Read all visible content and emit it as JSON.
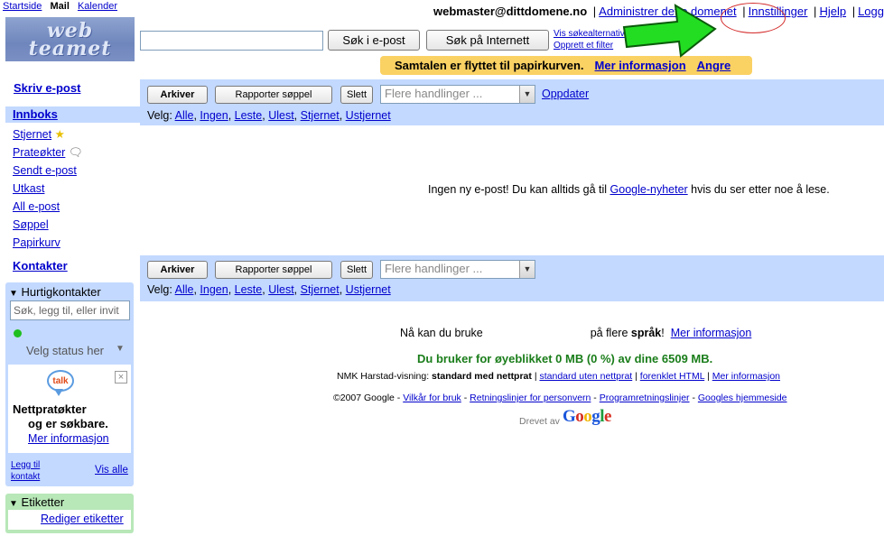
{
  "topnav": {
    "items": [
      "Startside",
      "Mail",
      "Kalender"
    ]
  },
  "logo": {
    "line1": "web",
    "line2": "teamet"
  },
  "user": {
    "email": "webmaster@dittdomene.no",
    "links": [
      "Administrer dette domenet",
      "Innstillinger",
      "Hjelp",
      "Logg av"
    ]
  },
  "search": {
    "value": "",
    "mail_button": "Søk i e-post",
    "web_button": "Søk på Internett",
    "options": "Vis søkealternativ",
    "filter": "Opprett et filter"
  },
  "notice": {
    "text": "Samtalen er flyttet til papirkurven.",
    "more": "Mer informasjon",
    "undo": "Angre"
  },
  "sidebar": {
    "compose": "Skriv e-post",
    "inbox": "Innboks",
    "items": [
      "Stjernet",
      "Prateøkter",
      "Sendt e-post",
      "Utkast",
      "All e-post",
      "Søppel",
      "Papirkurv"
    ],
    "contacts": "Kontakter"
  },
  "quickcontacts": {
    "title": "Hurtigkontakter",
    "search_placeholder": "Søk, legg til, eller invit",
    "status": "Velg status her",
    "talk_icon": "talk",
    "talk_line1": "Nettpratøkter",
    "talk_line2": "og er søkbare.",
    "talk_more": "Mer informasjon",
    "add_line1": "Legg til",
    "add_line2": "kontakt",
    "view_all": "Vis alle"
  },
  "labels": {
    "title": "Etiketter",
    "edit": "Rediger etiketter"
  },
  "toolbar": {
    "archive": "Arkiver",
    "report_spam": "Rapporter søppel",
    "delete": "Slett",
    "more_actions": "Flere handlinger ...",
    "refresh": "Oppdater",
    "select_label": "Velg:",
    "select_options": [
      "Alle",
      "Ingen",
      "Leste",
      "Ulest",
      "Stjernet",
      "Ustjernet"
    ]
  },
  "empty": {
    "text": "Ingen ny e-post! Du kan alltids gå til",
    "link": "Google-nyheter",
    "text2": "hvis du ser etter noe å lese."
  },
  "footer": {
    "line1_a": "Nå kan du bruke",
    "line1_b": "på flere",
    "line1_bold": "språk",
    "line1_c": "!",
    "line1_link": "Mer informasjon",
    "usage": "Du bruker for øyeblikket 0 MB (0 %) av dine 6509 MB.",
    "view_label": "NMK Harstad-visning:",
    "view_current": "standard med nettprat",
    "view_links": [
      "standard uten nettprat",
      "forenklet HTML",
      "Mer informasjon"
    ],
    "copyright": "©2007 Google",
    "legal_links": [
      "Vilkår for bruk",
      "Retningslinjer for personvern",
      "Programretningslinjer",
      "Googles hjemmeside"
    ],
    "powered": "Drevet av",
    "google_logo": "Google"
  },
  "colors": {
    "link": "#0000cc",
    "bar": "#c3d9ff",
    "notice": "#fad163",
    "usage": "#1a7d1a",
    "arrow": "#22dd22",
    "annotation": "#d42b2b"
  }
}
